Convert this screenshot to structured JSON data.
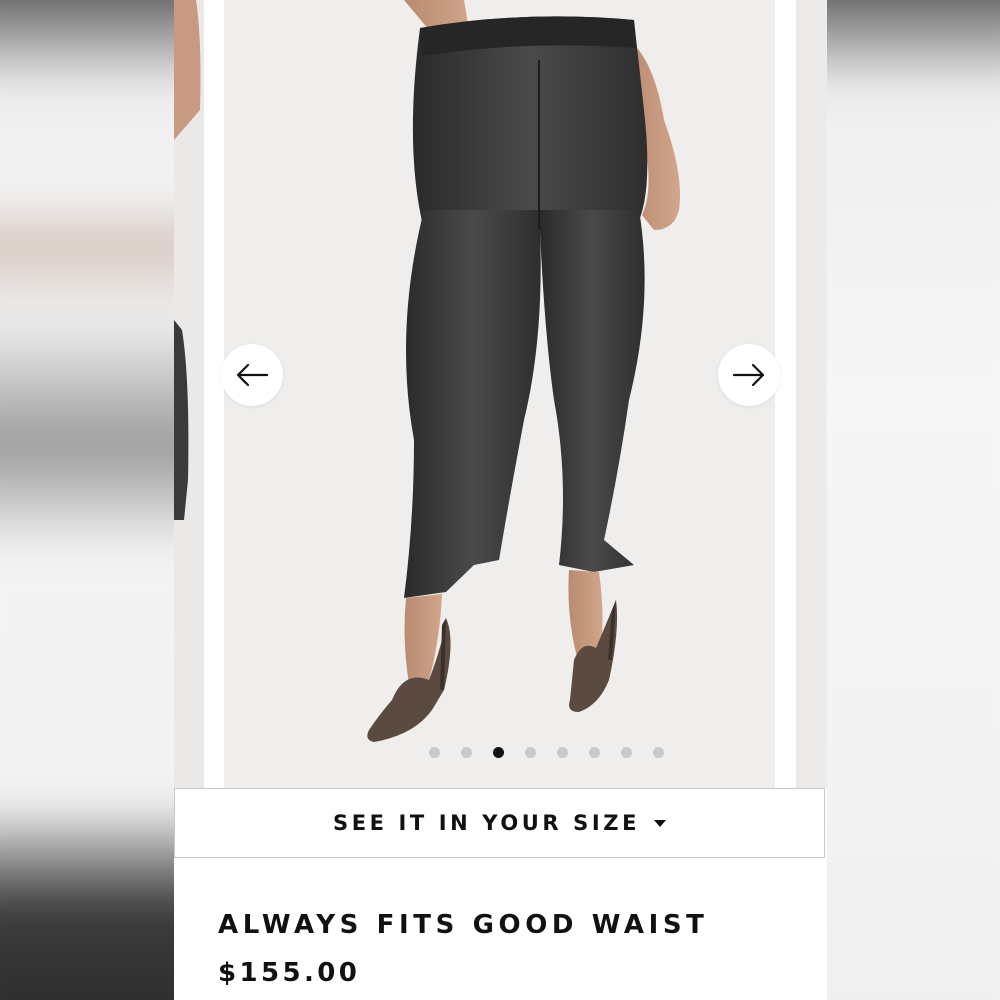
{
  "carousel": {
    "prev_label": "Previous image",
    "next_label": "Next image",
    "prev_icon": "arrow-left-icon",
    "next_icon": "arrow-right-icon",
    "dot_count": 8,
    "active_index": 2
  },
  "size_selector": {
    "label": "SEE IT IN YOUR SIZE",
    "icon": "caret-down-icon"
  },
  "product": {
    "title": "ALWAYS FITS GOOD WAIST",
    "price": "$155.00"
  },
  "colors": {
    "text": "#111111",
    "dot_inactive": "#c9c9c9",
    "dot_active": "#111111",
    "slide_background": "#efeeec",
    "denim": "#3a3a3a"
  }
}
